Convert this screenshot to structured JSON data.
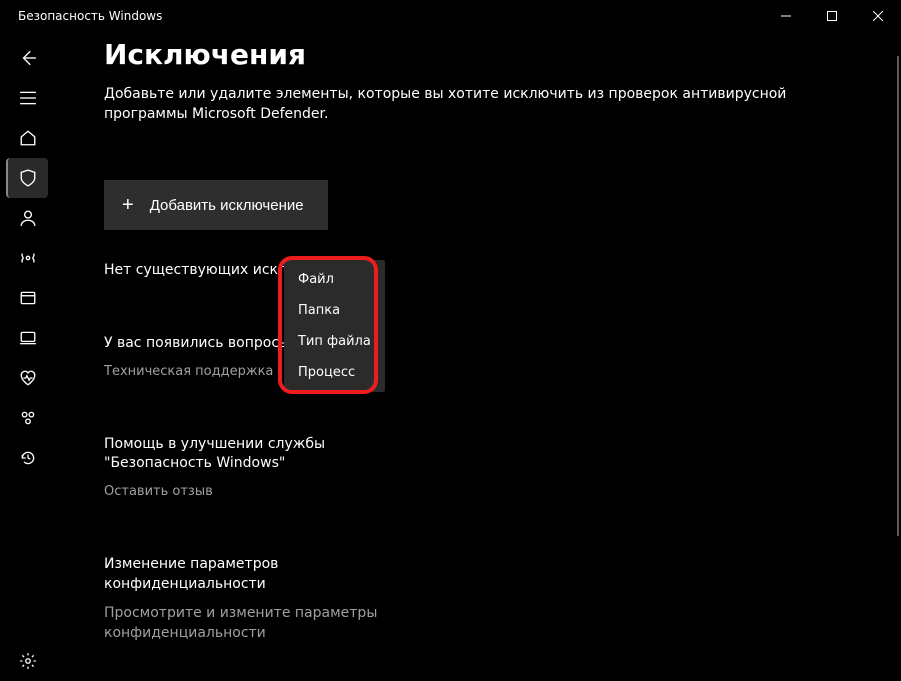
{
  "titlebar": {
    "title": "Безопасность Windows"
  },
  "page": {
    "title": "Исключения",
    "description": "Добавьте или удалите элементы, которые вы хотите исключить из проверок антивирусной программы Microsoft Defender."
  },
  "add_button": {
    "label": "Добавить исключение"
  },
  "dropdown": {
    "items": [
      "Файл",
      "Папка",
      "Тип файла",
      "Процесс"
    ]
  },
  "empty_text": "Нет существующих исключений.",
  "question_section": {
    "title": "У вас появились вопросы?",
    "link": "Техническая поддержка"
  },
  "improve_section": {
    "title": "Помощь в улучшении службы \"Безопасность Windows\"",
    "link": "Оставить отзыв"
  },
  "privacy_section": {
    "title": "Изменение параметров конфиденциальности",
    "sub": "Просмотрите и измените параметры конфиденциальности"
  }
}
